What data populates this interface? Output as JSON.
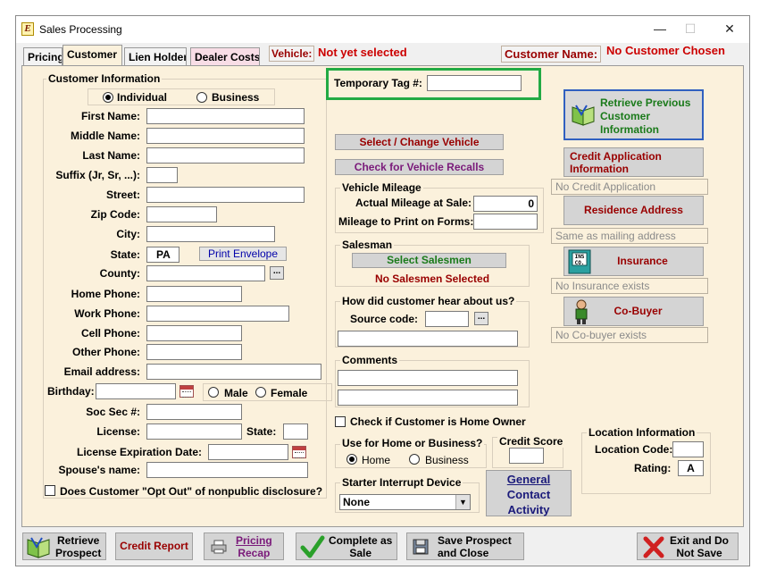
{
  "window": {
    "title": "Sales Processing"
  },
  "tabs": [
    "Pricing",
    "Customer",
    "Lien Holder",
    "Dealer Costs"
  ],
  "header": {
    "vehicle_label": "Vehicle:",
    "vehicle_value": "Not yet selected",
    "customer_label": "Customer Name:",
    "customer_value": "No Customer Chosen"
  },
  "customer_info": {
    "title": "Customer Information",
    "type_individual": "Individual",
    "type_business": "Business",
    "first_name": "First Name:",
    "middle_name": "Middle Name:",
    "last_name": "Last Name:",
    "suffix": "Suffix (Jr, Sr, ...):",
    "street": "Street:",
    "zip": "Zip Code:",
    "city": "City:",
    "state": "State:",
    "state_value": "PA",
    "print_envelope": "Print Envelope",
    "county": "County:",
    "home_phone": "Home Phone:",
    "work_phone": "Work Phone:",
    "cell_phone": "Cell Phone:",
    "other_phone": "Other Phone:",
    "email": "Email address:",
    "birthday": "Birthday:",
    "male": "Male",
    "female": "Female",
    "ssn": "Soc Sec #:",
    "license": "License:",
    "license_state": "State:",
    "license_exp": "License Expiration Date:",
    "spouse": "Spouse's name:",
    "opt_out": "Does Customer \"Opt Out\" of nonpublic disclosure?",
    "browse": "..."
  },
  "middle": {
    "temp_tag": "Temporary Tag #:",
    "select_vehicle": "Select / Change Vehicle",
    "recalls": "Check for Vehicle Recalls",
    "mileage_title": "Vehicle Mileage",
    "actual_mileage": "Actual Mileage at Sale:",
    "actual_mileage_value": "0",
    "mileage_print": "Mileage to Print on Forms:",
    "salesman_title": "Salesman",
    "select_salesmen": "Select Salesmen",
    "no_salesmen": "No Salesmen Selected",
    "hear_title": "How did customer hear about us?",
    "source_code": "Source code:",
    "comments_title": "Comments",
    "home_owner": "Check if Customer is Home Owner",
    "use_title": "Use for Home or Business?",
    "use_home": "Home",
    "use_business": "Business",
    "credit_score": "Credit Score",
    "starter_title": "Starter Interrupt Device",
    "starter_value": "None",
    "general_contact": [
      "General",
      "Contact",
      "Activity"
    ],
    "location_title": "Location Information",
    "location_code": "Location Code:",
    "rating": "Rating:",
    "rating_value": "A"
  },
  "right": {
    "retrieve_prev": [
      "Retrieve Previous",
      "Customer",
      "Information"
    ],
    "credit_app": [
      "Credit Application",
      "Information"
    ],
    "credit_app_status": "No Credit Application",
    "residence": "Residence Address",
    "residence_status": "Same as mailing address",
    "insurance": "Insurance",
    "insurance_status": "No Insurance exists",
    "cobuyer": "Co-Buyer",
    "cobuyer_status": "No Co-buyer exists"
  },
  "bottom": {
    "retrieve": [
      "Retrieve",
      "Prospect"
    ],
    "credit_report": "Credit Report",
    "pricing_recap": [
      "Pricing",
      "Recap"
    ],
    "complete": [
      "Complete as",
      "Sale"
    ],
    "save_close": [
      "Save Prospect",
      "and Close"
    ],
    "exit": [
      "Exit and Do",
      "Not Save"
    ]
  },
  "colors": {
    "panel": "#fbf1dc",
    "highlight": "#22aa44",
    "accent_red": "#cc0000"
  }
}
